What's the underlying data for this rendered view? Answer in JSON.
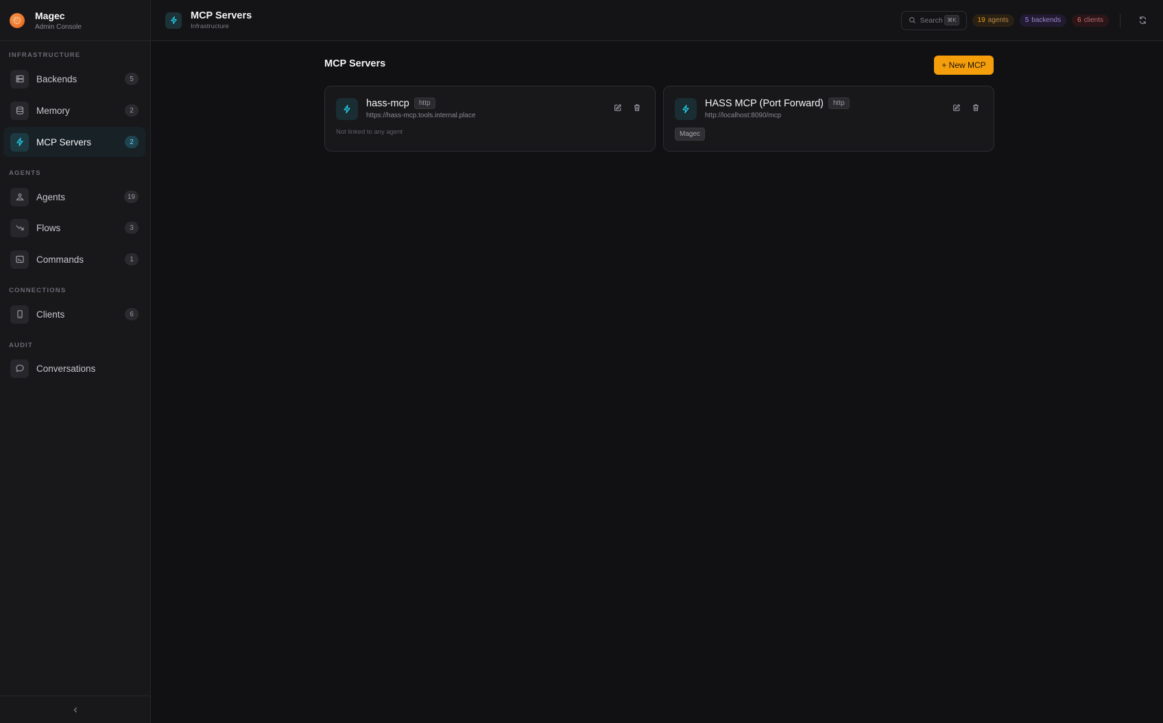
{
  "brand": {
    "name": "Magec",
    "subtitle": "Admin Console"
  },
  "sidebar": {
    "sections": [
      {
        "label": "Infrastructure"
      },
      {
        "label": "Agents"
      },
      {
        "label": "Connections"
      },
      {
        "label": "Audit"
      }
    ],
    "items": [
      {
        "label": "Backends",
        "count": "5",
        "icon": "server-icon"
      },
      {
        "label": "Memory",
        "count": "2",
        "icon": "database-icon"
      },
      {
        "label": "MCP Servers",
        "count": "2",
        "icon": "bolt-icon",
        "active": true
      },
      {
        "label": "Agents",
        "count": "19",
        "icon": "agents-icon"
      },
      {
        "label": "Flows",
        "count": "3",
        "icon": "trend-icon"
      },
      {
        "label": "Commands",
        "count": "1",
        "icon": "terminal-icon"
      },
      {
        "label": "Clients",
        "count": "6",
        "icon": "phone-icon"
      },
      {
        "label": "Conversations",
        "count": null,
        "icon": "chat-icon"
      }
    ]
  },
  "header": {
    "title": "MCP Servers",
    "subtitle": "Infrastructure",
    "search_label": "Search",
    "search_shortcut": "⌘K",
    "stats": {
      "agents_count": "19",
      "agents_label": "agents",
      "backends_count": "5",
      "backends_label": "backends",
      "clients_count": "6",
      "clients_label": "clients"
    }
  },
  "main": {
    "title": "MCP Servers",
    "new_button": "+ New MCP",
    "servers": [
      {
        "name": "hass-mcp",
        "transport": "http",
        "url": "https://hass-mcp.tools.internal.place",
        "footer_text": "Not linked to any agent"
      },
      {
        "name": "HASS MCP (Port Forward)",
        "transport": "http",
        "url": "http://localhost:8090/mcp",
        "linked_agent": "Magec"
      }
    ]
  },
  "colors": {
    "accent": "#f59e0b",
    "active_icon": "#22d3ee",
    "background": "#111113"
  }
}
